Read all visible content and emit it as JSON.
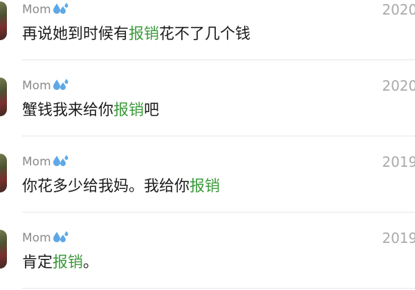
{
  "results": [
    {
      "sender": "Mom",
      "date": "2020/",
      "message_parts": [
        "再说她到时候有",
        "报销",
        "花不了几个钱"
      ],
      "highlight": "报销"
    },
    {
      "sender": "Mom",
      "date": "2020/",
      "message_parts": [
        "蟹钱我来给你",
        "报销",
        "吧"
      ],
      "highlight": "报销"
    },
    {
      "sender": "Mom",
      "date": "2019/",
      "message_parts": [
        "你花多少给我妈。我给你",
        "报销",
        ""
      ],
      "highlight": "报销"
    },
    {
      "sender": "Mom",
      "date": "2019/",
      "message_parts": [
        "肯定",
        "报销",
        "。"
      ],
      "highlight": "报销"
    }
  ],
  "colors": {
    "highlight": "#3a9a3a",
    "sender": "#8a8a8a",
    "date": "#a9a9a9",
    "message": "#1b1b1b"
  },
  "icons": {
    "sender_emoji": "sweat-droplets-icon",
    "avatar": "avatar-photo"
  }
}
